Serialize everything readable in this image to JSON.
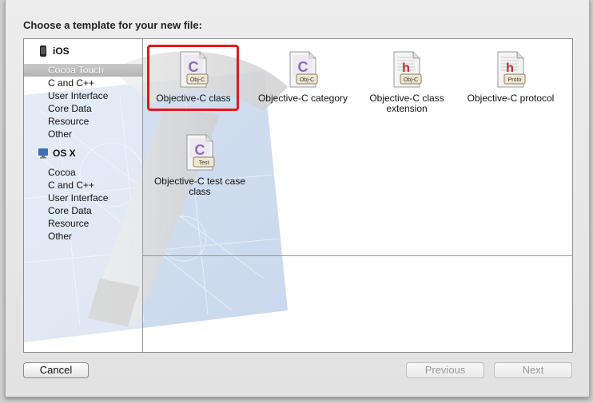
{
  "dialog": {
    "title": "Choose a template for your new file:"
  },
  "sidebar": {
    "groups": [
      {
        "name": "iOS",
        "icon": "iphone-icon",
        "items": [
          "Cocoa Touch",
          "C and C++",
          "User Interface",
          "Core Data",
          "Resource",
          "Other"
        ],
        "selected": "Cocoa Touch"
      },
      {
        "name": "OS X",
        "icon": "mac-icon",
        "items": [
          "Cocoa",
          "C and C++",
          "User Interface",
          "Core Data",
          "Resource",
          "Other"
        ]
      }
    ]
  },
  "templates": [
    {
      "label": "Objective-C class",
      "badge": "Obj-C",
      "glyph": "C",
      "selected": true
    },
    {
      "label": "Objective-C category",
      "badge": "Obj-C",
      "glyph": "C"
    },
    {
      "label": "Objective-C class extension",
      "badge": "Obj-C",
      "glyph": "h"
    },
    {
      "label": "Objective-C protocol",
      "badge": "Proto",
      "glyph": "h"
    },
    {
      "label": "Objective-C test case class",
      "badge": "Test",
      "glyph": "C"
    }
  ],
  "buttons": {
    "cancel": "Cancel",
    "previous": "Previous",
    "next": "Next"
  },
  "colors": {
    "highlight": "#e01a1a",
    "glyph_c": "#8a6bb5",
    "glyph_h": "#c0282a"
  }
}
